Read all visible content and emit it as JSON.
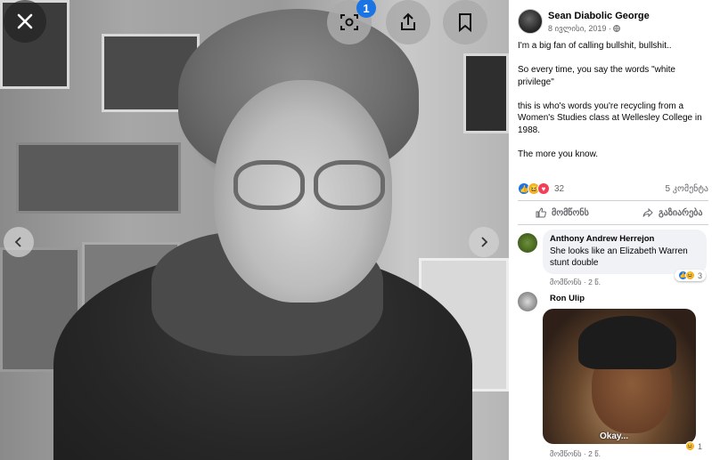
{
  "viewer": {
    "notification_count": "1",
    "icons": {
      "close": "close-icon",
      "lens": "visual-search-icon",
      "share": "share-icon",
      "save": "bookmark-icon",
      "prev": "chevron-left-icon",
      "next": "chevron-right-icon"
    }
  },
  "post": {
    "author": "Sean Diabolic George",
    "date": "8 ივლისი, 2019",
    "audience_icon": "globe-icon",
    "lines": [
      "I'm a big fan of calling bullshit, bullshit..",
      "So every time, you say the words \"white privilege\"",
      "this is who's words you're recycling from a Women's Studies class at Wellesley College in 1988.",
      "The more you know."
    ],
    "reaction_count": "32",
    "comment_count": "5 კომენტა",
    "like_label": "მომწონს",
    "share_label": "გაზიარება"
  },
  "comments": [
    {
      "author": "Anthony Andrew Herrejon",
      "text": "She looks like an Elizabeth Warren stunt double",
      "like_label": "მომწონს",
      "time": "2 წ.",
      "reaction_count": "3"
    },
    {
      "author": "Ron Ulip",
      "gif_caption": "Okay...",
      "like_label": "მომწონს",
      "time": "2 წ.",
      "reaction_count": "1"
    }
  ],
  "colors": {
    "accent": "#1b74e4",
    "like": "#1b74e4",
    "haha": "#f7b125",
    "love": "#f33e58",
    "secondary_text": "#65676b"
  }
}
